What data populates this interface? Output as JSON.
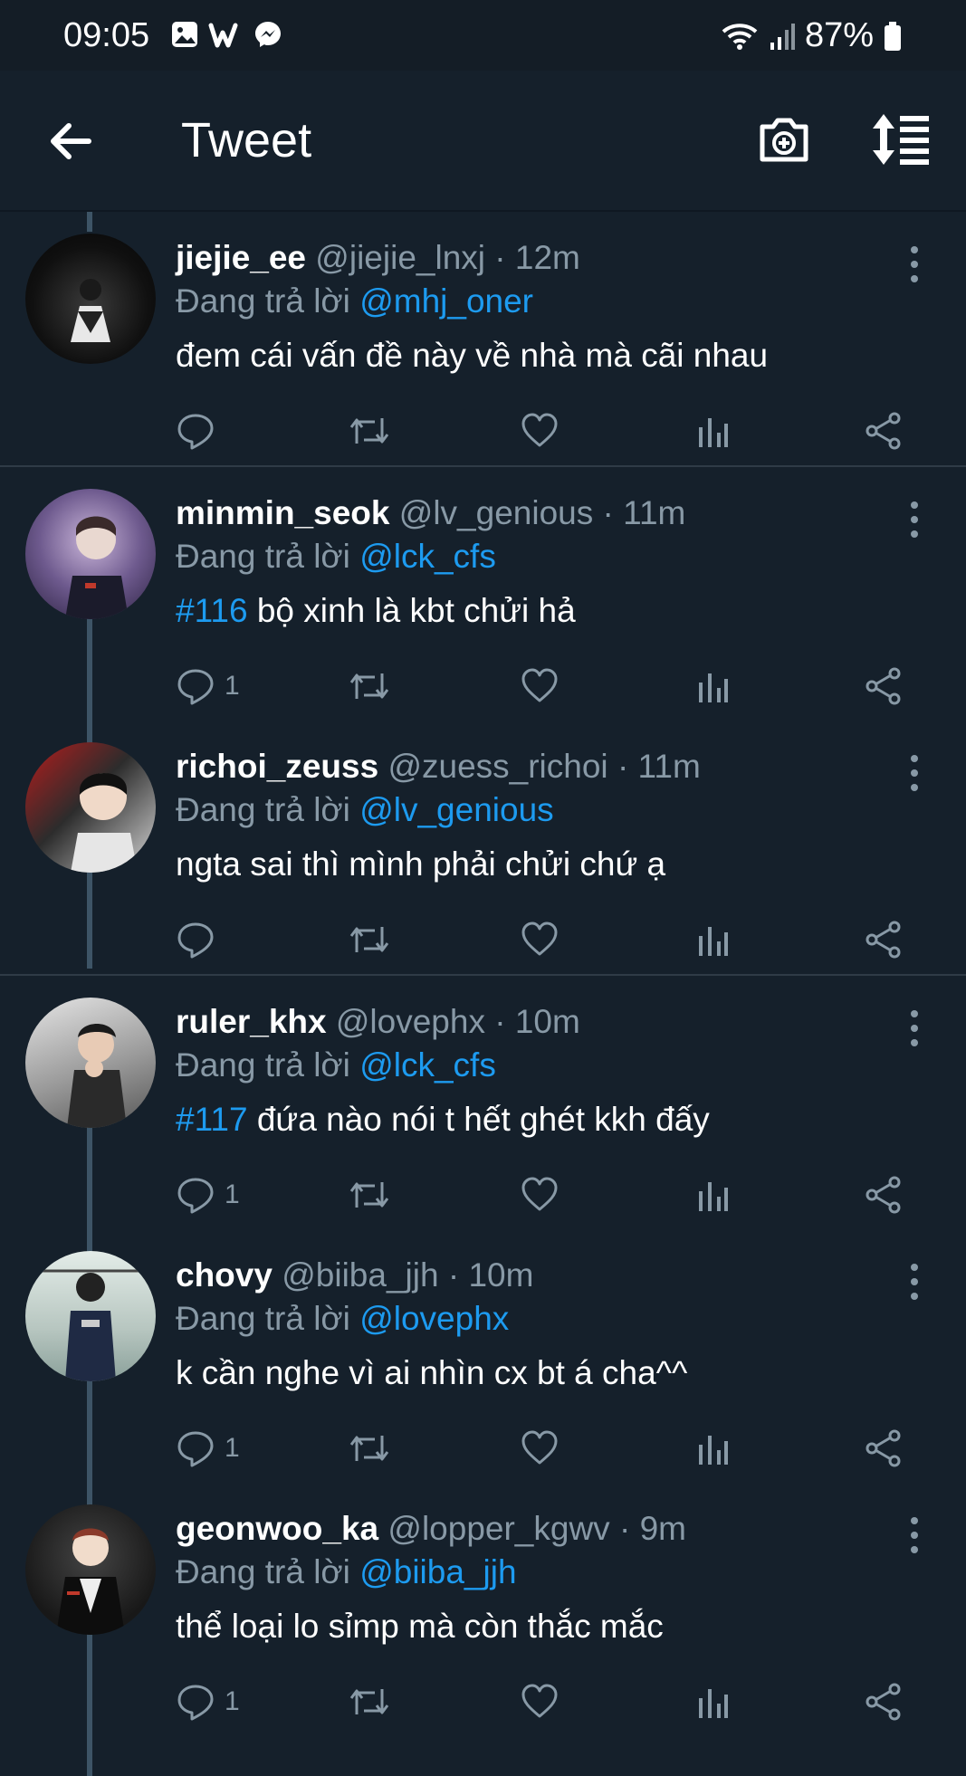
{
  "status_bar": {
    "time": "09:05",
    "battery": "87%"
  },
  "app_bar": {
    "title": "Tweet"
  },
  "reply_prefix": "Đang trả lời",
  "tweets": [
    {
      "name": "jiejie_ee",
      "handle": "@jiejie_lnxj",
      "time": "12m",
      "reply_to": "@mhj_oner",
      "hashtag": "",
      "text": "đem cái vấn đề này về nhà mà cãi nhau",
      "reply_count": ""
    },
    {
      "name": "minmin_seok",
      "handle": "@lv_genious",
      "time": "11m",
      "reply_to": "@lck_cfs",
      "hashtag": "#116",
      "text": "bộ xinh là kbt chửi hả",
      "reply_count": "1"
    },
    {
      "name": "richoi_zeuss",
      "handle": "@zuess_richoi",
      "time": "11m",
      "reply_to": "@lv_genious",
      "hashtag": "",
      "text": "ngta sai thì mình phải chửi chứ ạ",
      "reply_count": ""
    },
    {
      "name": "ruler_khx",
      "handle": "@lovephx",
      "time": "10m",
      "reply_to": "@lck_cfs",
      "hashtag": "#117",
      "text": "đứa nào nói t hết ghét kkh đấy",
      "reply_count": "1"
    },
    {
      "name": "chovy",
      "handle": "@biiba_jjh",
      "time": "10m",
      "reply_to": "@lovephx",
      "hashtag": "",
      "text": "k cần nghe vì ai nhìn cx bt á cha^^",
      "reply_count": "1"
    },
    {
      "name": "geonwoo_ka",
      "handle": "@lopper_kgwv",
      "time": "9m",
      "reply_to": "@biiba_jjh",
      "hashtag": "",
      "text": "thể loại lo sỉmp mà còn thắc mắc",
      "reply_count": "1"
    }
  ],
  "colors": {
    "background": "#15202b",
    "accent": "#1d9bf0",
    "muted": "#8899a6"
  }
}
